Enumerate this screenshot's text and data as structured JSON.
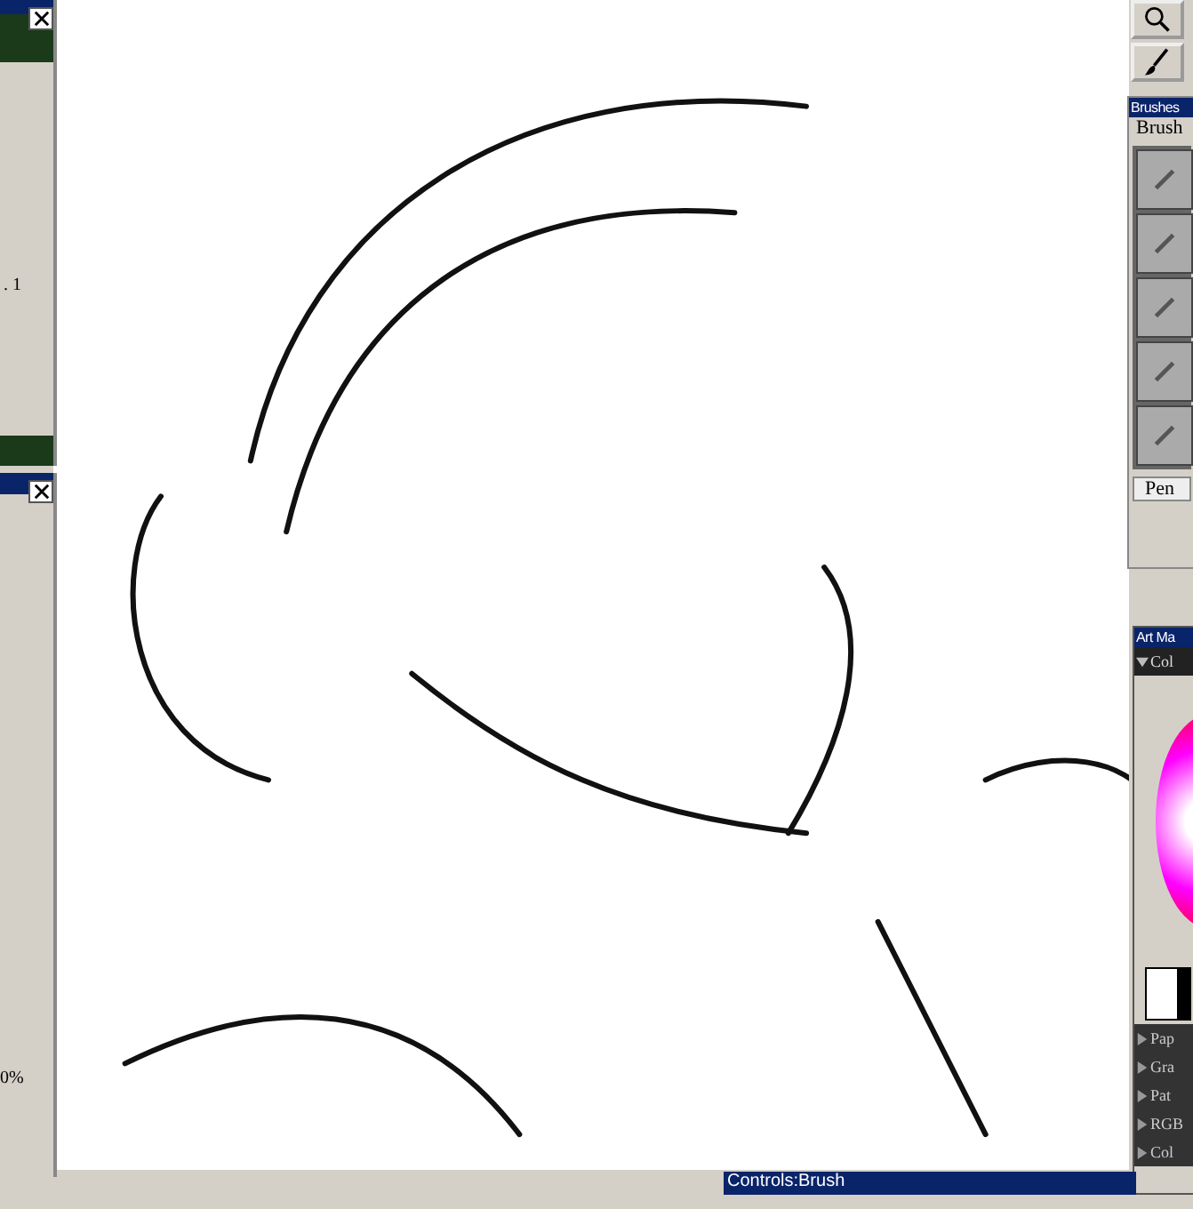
{
  "left_panels": [
    {
      "text": ". 1"
    },
    {
      "text": "0%"
    }
  ],
  "brushes_palette": {
    "title": "Brushes",
    "category": "Brush",
    "variant": "Pen"
  },
  "art_materials": {
    "title": "Art Ma",
    "sections": [
      {
        "label": "Col",
        "expanded": true
      },
      {
        "label": "Pap",
        "expanded": false
      },
      {
        "label": "Gra",
        "expanded": false
      },
      {
        "label": "Pat",
        "expanded": false
      },
      {
        "label": "RGB",
        "expanded": false
      },
      {
        "label": "Col",
        "expanded": false
      }
    ]
  },
  "controls_bar": {
    "title": "Controls:Brush"
  }
}
